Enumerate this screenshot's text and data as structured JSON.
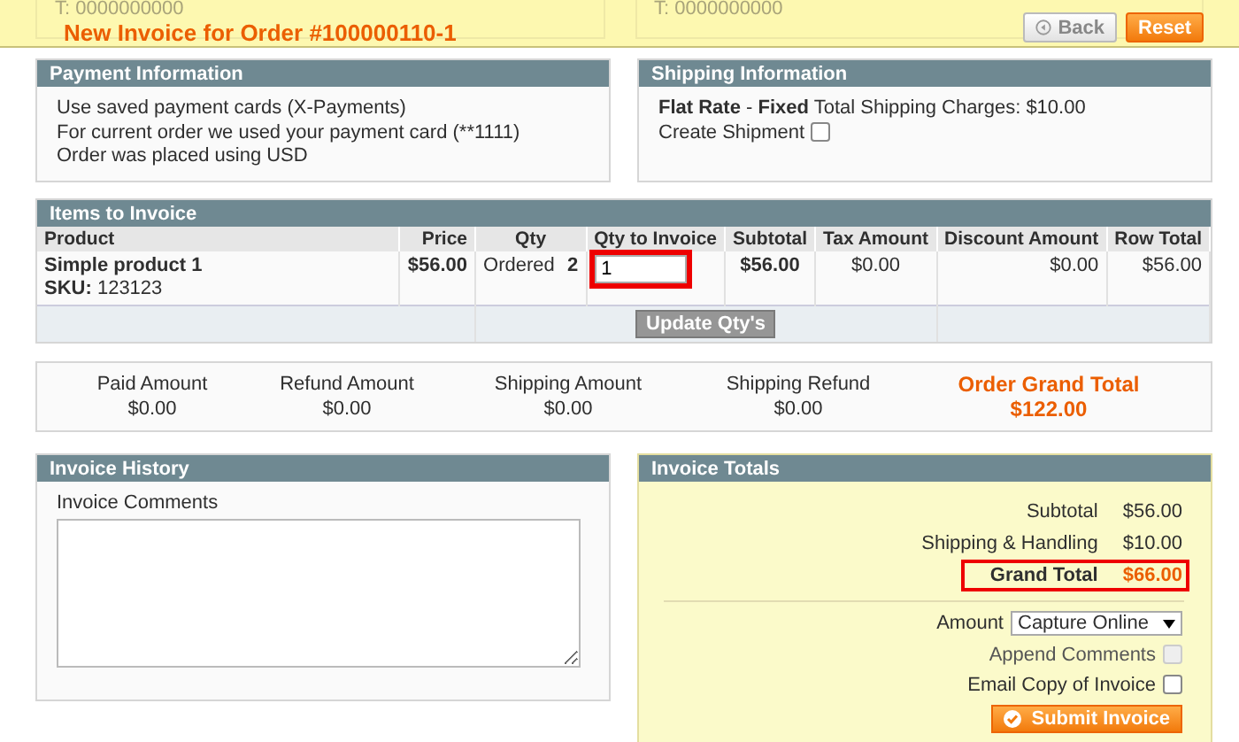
{
  "header": {
    "background_texts": [
      "T: 0000000000",
      "T: 0000000000"
    ],
    "title": "New Invoice for Order #100000110-1",
    "buttons": [
      {
        "label": "Back",
        "kind": "back"
      },
      {
        "label": "Reset",
        "kind": "reset"
      }
    ]
  },
  "payment_information": {
    "title": "Payment Information",
    "lines": [
      "Use saved payment cards (X-Payments)",
      "For current order we used your payment card (**1111)",
      "Order was placed using USD"
    ]
  },
  "shipping_information": {
    "title": "Shipping Information",
    "method": "**Flat Rate** - **Fixed** Total Shipping Charges: $10.00",
    "create_shipment": {
      "label": "Create Shipment",
      "checked": false
    }
  },
  "items_to_invoice": {
    "title": "Items to Invoice",
    "columns": [
      "Product",
      "Price",
      "Qty",
      "Qty to Invoice",
      "Subtotal",
      "Tax Amount",
      "Discount Amount",
      "Row Total"
    ],
    "rows": [
      {
        "product": "Simple product 1",
        "sku_label": "SKU:",
        "sku": "123123",
        "price": "$56.00",
        "qty_label": "Ordered",
        "qty": "2",
        "qty_to_invoice": "1",
        "qty_highlighted": true,
        "subtotal": "$56.00",
        "tax_amount": "$0.00",
        "discount_amount": "$0.00",
        "row_total": "$56.00"
      }
    ],
    "update_button": "Update Qty's"
  },
  "order_summary": [
    {
      "label": "Paid Amount",
      "value": "$0.00",
      "kind": "plain"
    },
    {
      "label": "Refund Amount",
      "value": "$0.00",
      "kind": "plain"
    },
    {
      "label": "Shipping Amount",
      "value": "$0.00",
      "kind": "plain"
    },
    {
      "label": "Shipping Refund",
      "value": "$0.00",
      "kind": "plain"
    },
    {
      "label": "Order Grand Total",
      "value": "$122.00",
      "kind": "grand"
    }
  ],
  "invoice_history": {
    "title": "Invoice History",
    "comments_label": "Invoice Comments"
  },
  "invoice_totals": {
    "title": "Invoice Totals",
    "rows": [
      {
        "label": "Subtotal",
        "value": "$56.00",
        "kind": "plain",
        "highlighted": false
      },
      {
        "label": "Shipping & Handling",
        "value": "$10.00",
        "kind": "plain",
        "highlighted": false
      },
      {
        "label": "Grand Total",
        "value": "$66.00",
        "kind": "grand",
        "highlighted": true
      }
    ],
    "amount": {
      "label": "Amount",
      "value": "Capture Online"
    },
    "options": [
      {
        "label": "Append Comments",
        "checked": false,
        "disabled": true
      },
      {
        "label": "Email Copy of Invoice",
        "checked": false,
        "disabled": false
      }
    ],
    "submit_button": "Submit Invoice"
  }
}
